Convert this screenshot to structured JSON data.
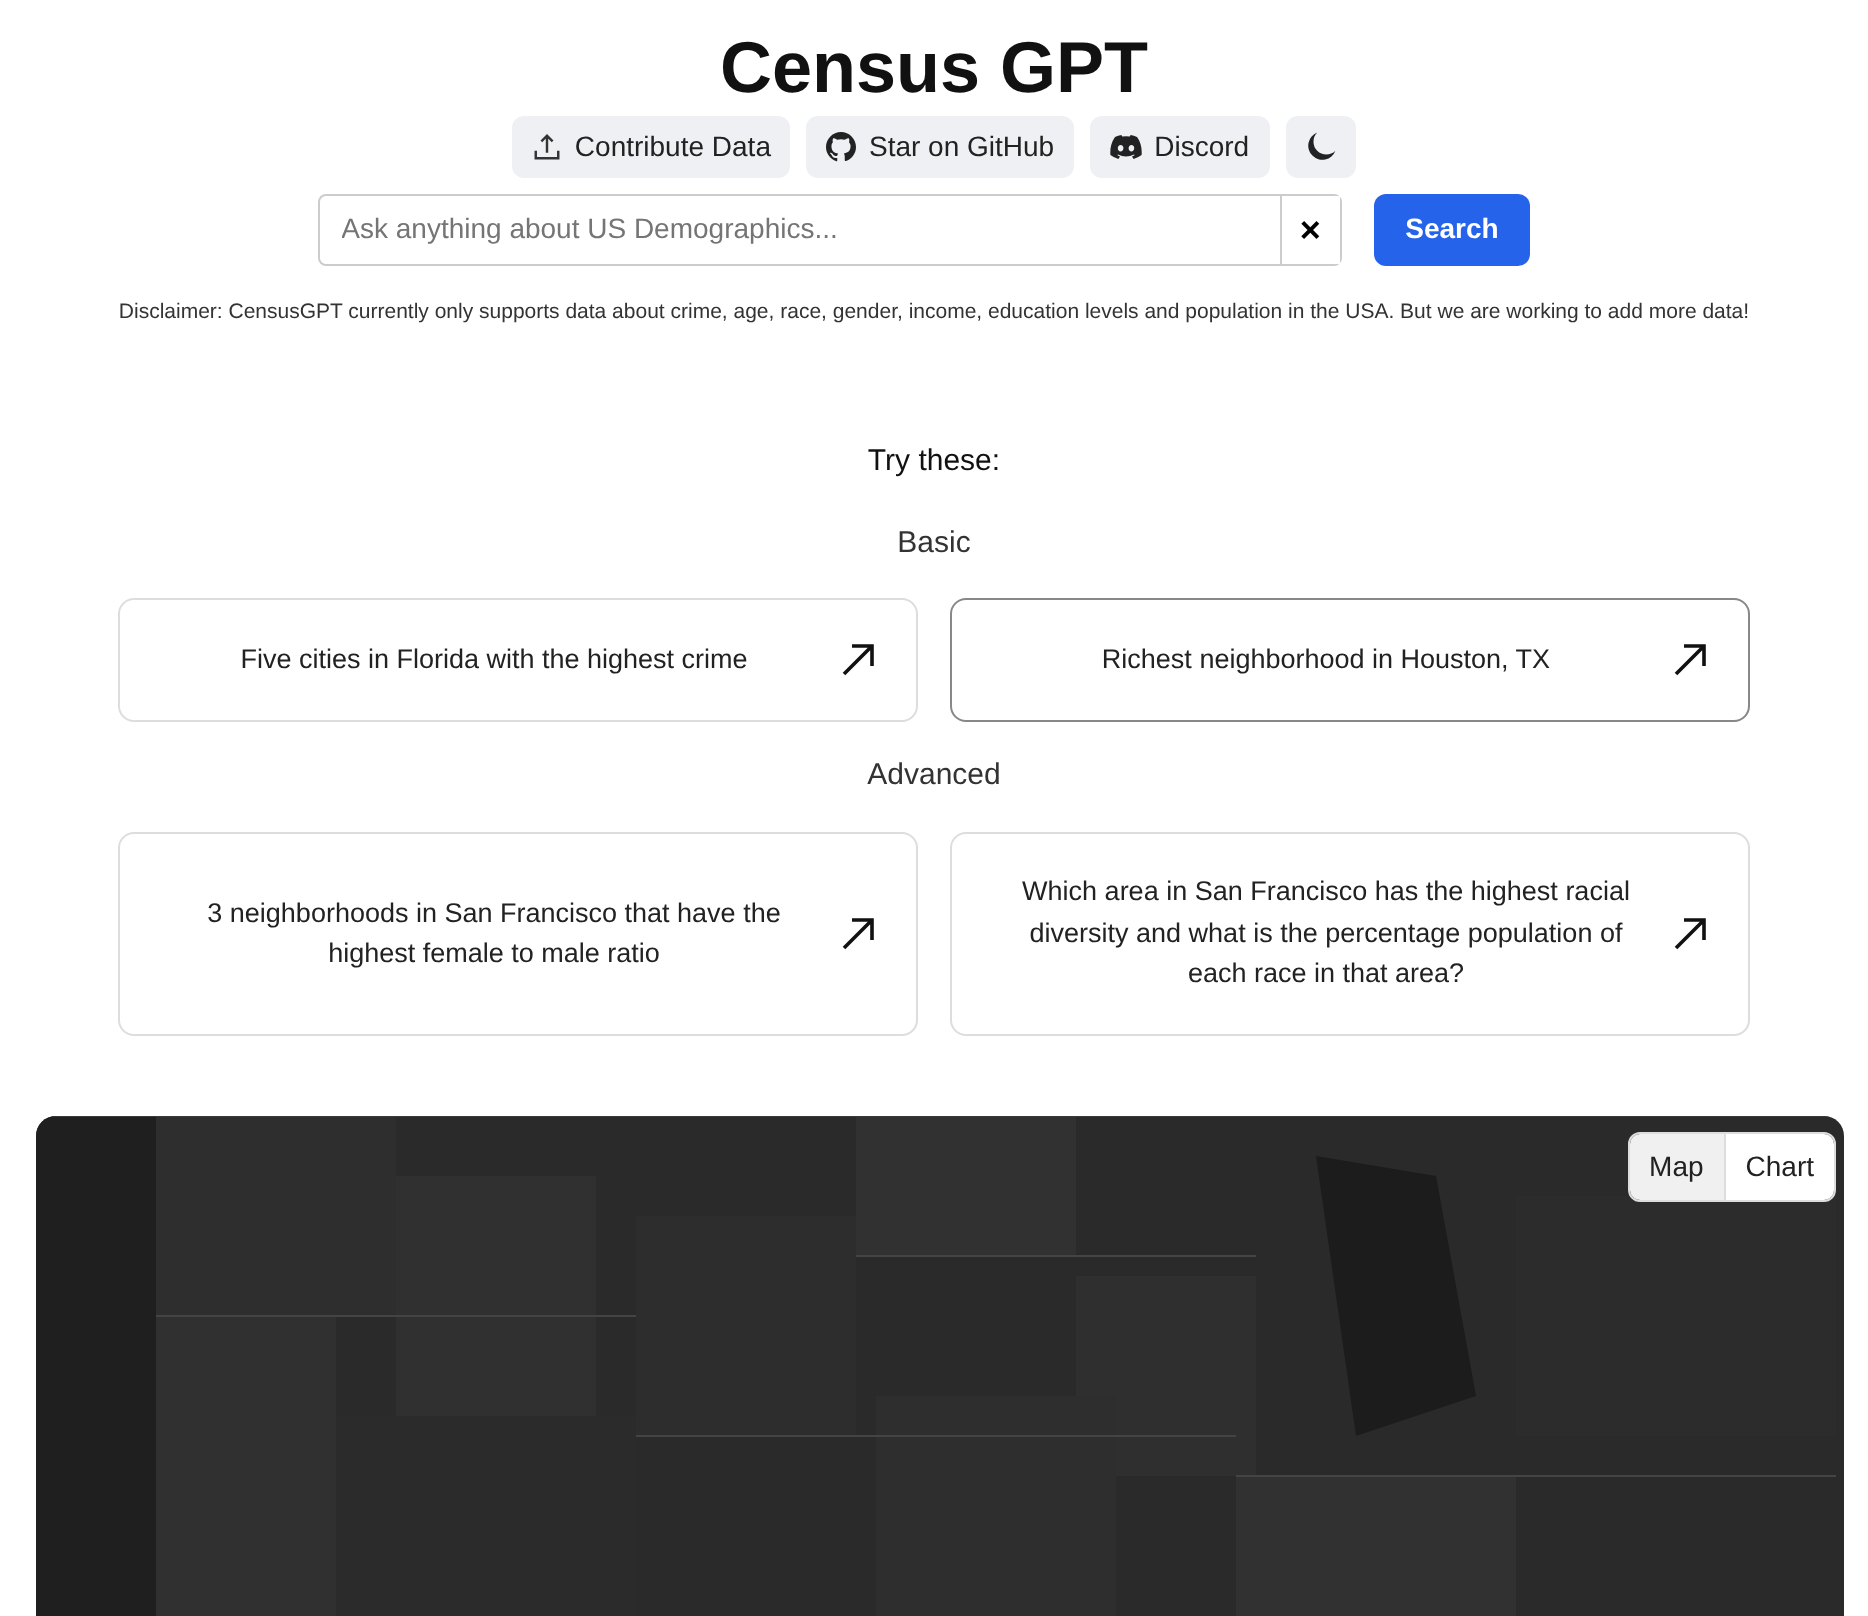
{
  "title": "Census GPT",
  "links": [
    {
      "kind": "upload",
      "label": "Contribute Data"
    },
    {
      "kind": "github",
      "label": "Star on GitHub"
    },
    {
      "kind": "discord",
      "label": "Discord"
    },
    {
      "kind": "theme"
    }
  ],
  "search": {
    "placeholder": "Ask anything about US Demographics...",
    "clear": "×",
    "button": "Search"
  },
  "disclaimer": "Disclaimer: CensusGPT currently only supports data about crime, age, race, gender, income, education levels and population in the USA. But we are working to add more data!",
  "try_heading": "Try these:",
  "sections": [
    {
      "heading": "Basic",
      "examples": [
        {
          "text": "Five cities in Florida with the highest crime",
          "highlighted": false
        },
        {
          "text": "Richest neighborhood in Houston, TX",
          "highlighted": true
        }
      ]
    },
    {
      "heading": "Advanced",
      "examples": [
        {
          "text": "3 neighborhoods in San Francisco that have the highest female to male ratio",
          "highlighted": false
        },
        {
          "text": "Which area in San Francisco has the highest racial diversity and what is the percentage population of each race in that area?",
          "highlighted": false
        }
      ]
    }
  ],
  "view_toggle": [
    {
      "label": "Map",
      "selected": true
    },
    {
      "label": "Chart",
      "selected": false
    }
  ]
}
